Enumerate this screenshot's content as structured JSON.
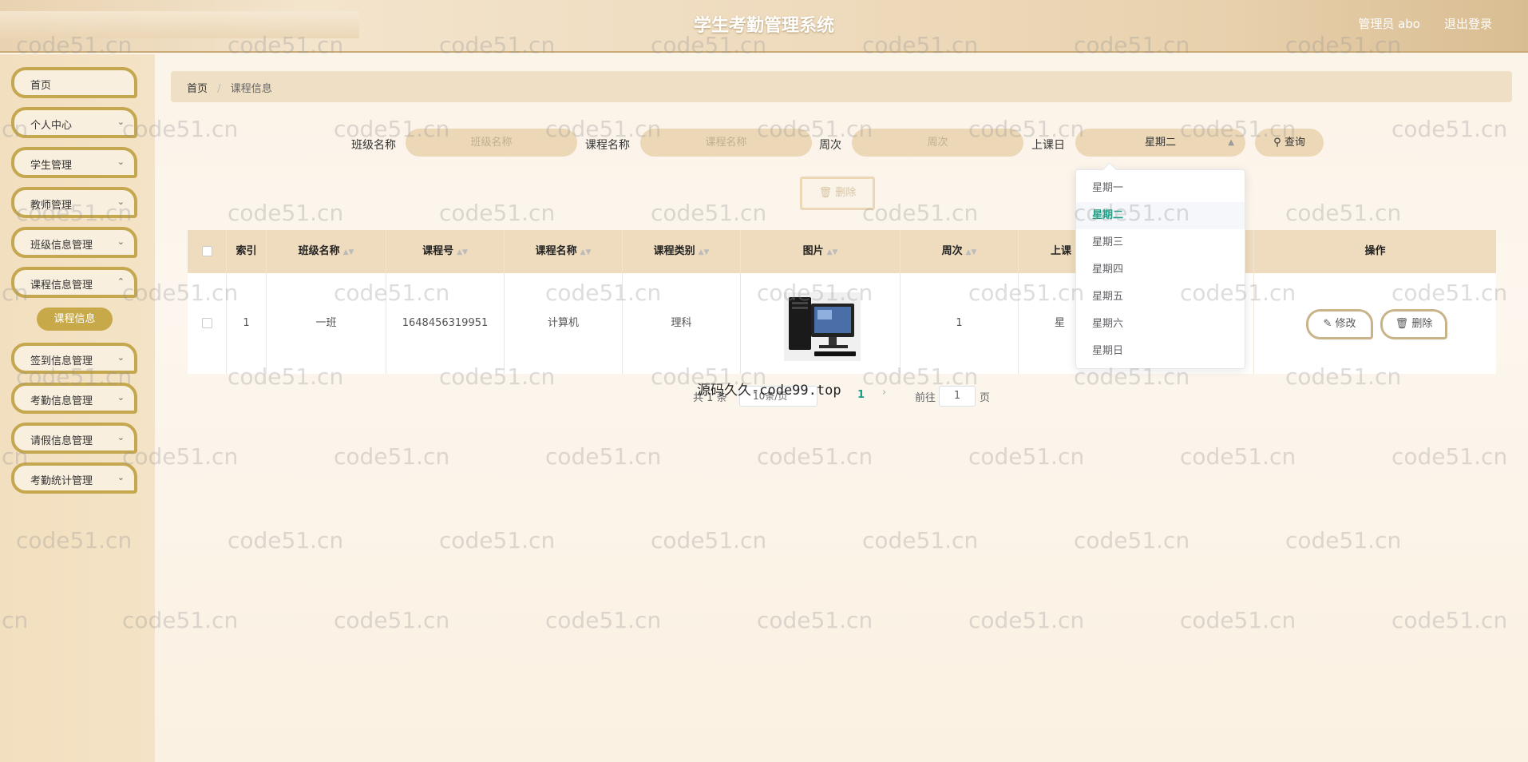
{
  "header": {
    "title": "学生考勤管理系统",
    "admin": "管理员 abo",
    "logout": "退出登录"
  },
  "sidebar": {
    "items": [
      {
        "label": "首页"
      },
      {
        "label": "个人中心"
      },
      {
        "label": "学生管理"
      },
      {
        "label": "教师管理"
      },
      {
        "label": "班级信息管理"
      },
      {
        "label": "课程信息管理"
      },
      {
        "label": "签到信息管理"
      },
      {
        "label": "考勤信息管理"
      },
      {
        "label": "请假信息管理"
      },
      {
        "label": "考勤统计管理"
      }
    ],
    "sub_item": "课程信息"
  },
  "breadcrumb": {
    "home": "首页",
    "sep": "/",
    "current": "课程信息"
  },
  "search": {
    "class_label": "班级名称",
    "class_placeholder": "班级名称",
    "course_label": "课程名称",
    "course_placeholder": "课程名称",
    "week_label": "周次",
    "week_placeholder": "周次",
    "day_label": "上课日",
    "day_value": "星期二",
    "query": "查询"
  },
  "delete_button": "删除",
  "table": {
    "headers": [
      "索引",
      "班级名称",
      "课程号",
      "课程名称",
      "课程类别",
      "图片",
      "周次",
      "上课",
      "操作"
    ],
    "row": {
      "index": "1",
      "class_name": "一班",
      "course_no": "1648456319951",
      "course_name": "计算机",
      "course_type": "理科",
      "week": "1",
      "day": "星"
    },
    "edit": "修改",
    "delete": "删除"
  },
  "dropdown": {
    "options": [
      "星期一",
      "星期二",
      "星期三",
      "星期四",
      "星期五",
      "星期六",
      "星期日"
    ],
    "selected": "星期二"
  },
  "pagination": {
    "total": "共 1 条",
    "page_size": "10条/页",
    "current_page": "1",
    "goto": "前往",
    "goto_value": "1",
    "page_unit": "页"
  },
  "overlay": "源码久久-code99.top",
  "watermark": "code51.cn",
  "colors": {
    "accent": "#c4a74e",
    "selected_option": "#16a085",
    "header_bg": "#efdcbf"
  }
}
